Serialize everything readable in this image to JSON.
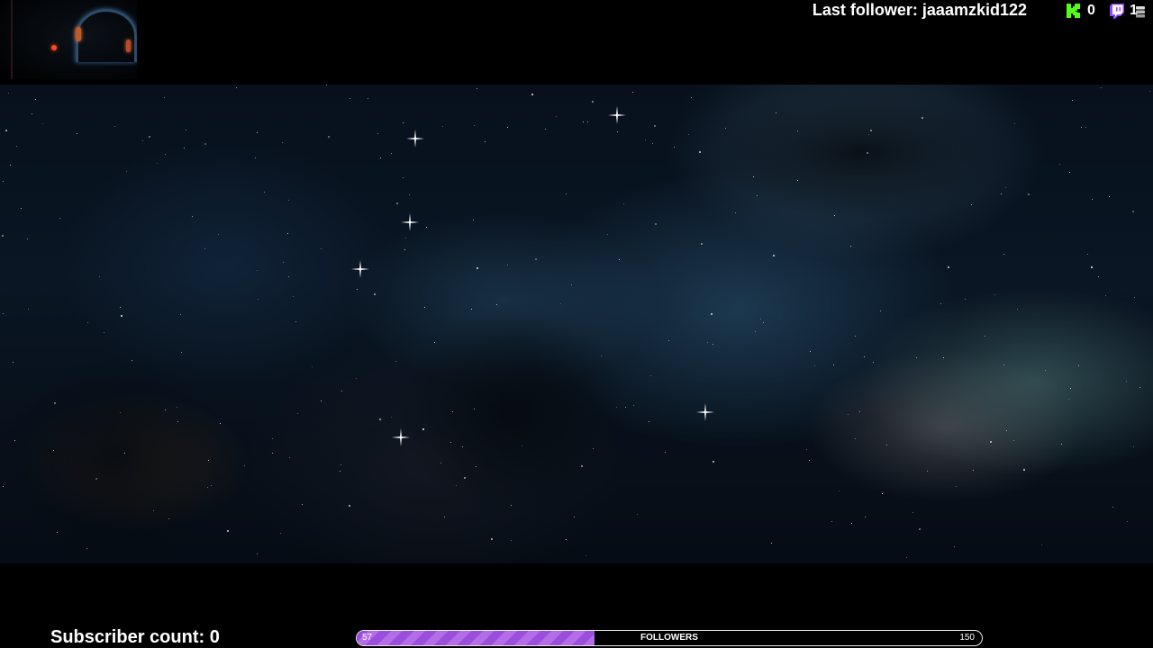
{
  "overlay": {
    "last_follower_text": "Last follower: jaaamzkid122",
    "kick_count": "0",
    "twitch_count": "1",
    "subscriber_text": "Subscriber count: 0",
    "goal": {
      "current": 57,
      "target": 150,
      "current_label": "57",
      "target_label": "150",
      "label": "FOLLOWERS",
      "progress_fraction": 0.38
    }
  },
  "colors": {
    "kick_green": "#53fc18",
    "twitch_purple": "#9146ff",
    "goal_fill": "#9b4ddb",
    "background": "#000000"
  },
  "icons": {
    "kick": "kick-logo-icon",
    "twitch": "twitch-logo-icon",
    "stack": "stack-icon"
  }
}
